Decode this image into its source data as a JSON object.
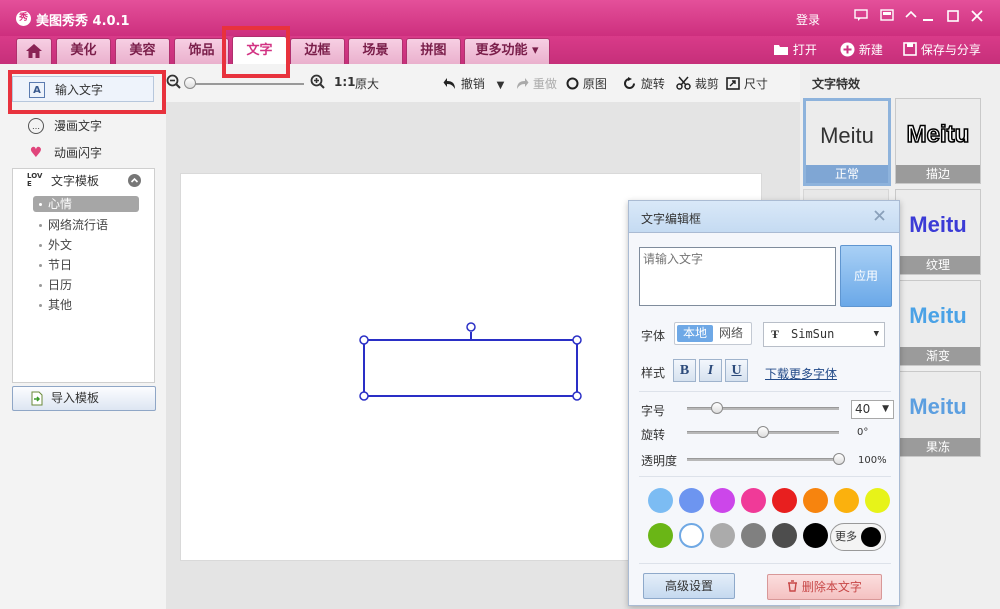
{
  "app": {
    "title": "美图秀秀 4.0.1",
    "logo": "秀",
    "login": "登录"
  },
  "window": {
    "message": "☐",
    "skin": "▣",
    "menu": "▾",
    "minimize": "—",
    "maximize": "☐",
    "close": "✕"
  },
  "nav": {
    "home_icon": "home-icon",
    "tabs": [
      {
        "label": "美化"
      },
      {
        "label": "美容"
      },
      {
        "label": "饰品"
      },
      {
        "label": "文字"
      },
      {
        "label": "边框"
      },
      {
        "label": "场景"
      },
      {
        "label": "拼图"
      },
      {
        "label": "更多功能 ▾"
      }
    ],
    "active_tab": "文字",
    "open": "打开",
    "new": "新建",
    "save": "保存与分享"
  },
  "left": {
    "items": [
      {
        "label": "输入文字",
        "icon": "A"
      },
      {
        "label": "漫画文字",
        "icon": "…"
      },
      {
        "label": "动画闪字",
        "icon": "♥"
      }
    ],
    "template": {
      "title": "文字模板",
      "icon": "LOVE",
      "subs": [
        {
          "label": "心情"
        },
        {
          "label": "网络流行语"
        },
        {
          "label": "外文"
        },
        {
          "label": "节日"
        },
        {
          "label": "日历"
        },
        {
          "label": "其他"
        }
      ]
    },
    "import_label": "导入模板"
  },
  "toolbar": {
    "zoom_reset": "1:1",
    "original_size": "原大",
    "undo": "撤销",
    "redo": "重做",
    "original": "原图",
    "rotate": "旋转",
    "crop": "裁剪",
    "size": "尺寸",
    "zoom_level": 0.02
  },
  "effects": {
    "title": "文字特效",
    "sample": "Meitu",
    "items": [
      {
        "label": "正常"
      },
      {
        "label": "描边"
      },
      {
        "label": "纹理"
      },
      {
        "label": "渐变"
      },
      {
        "label": "果冻"
      }
    ]
  },
  "dialog": {
    "title": "文字编辑框",
    "text_placeholder": "请输入文字",
    "apply": "应用",
    "font_label": "字体",
    "font_local": "本地",
    "font_net": "网络",
    "font_value": "SimSun",
    "style_label": "样式",
    "bold": "B",
    "italic": "I",
    "underline": "U",
    "download_fonts": "下载更多字体",
    "size_label": "字号",
    "size_value": "40",
    "size_fraction": 0.2,
    "rotate_label": "旋转",
    "rotate_value": "0°",
    "rotate_fraction": 0.5,
    "opacity_label": "透明度",
    "opacity_value": "100%",
    "opacity_fraction": 1.0,
    "more": "更多",
    "advanced": "高级设置",
    "delete": "删除本文字",
    "colors": [
      "#7cbcf3",
      "#6d95f0",
      "#cc46ea",
      "#f03a98",
      "#e81f1f",
      "#f7840e",
      "#fbb10d",
      "#e7f319",
      "#6ab616",
      "#ffffff",
      "#ababab",
      "#808080",
      "#4d4d4d",
      "#000000"
    ]
  }
}
